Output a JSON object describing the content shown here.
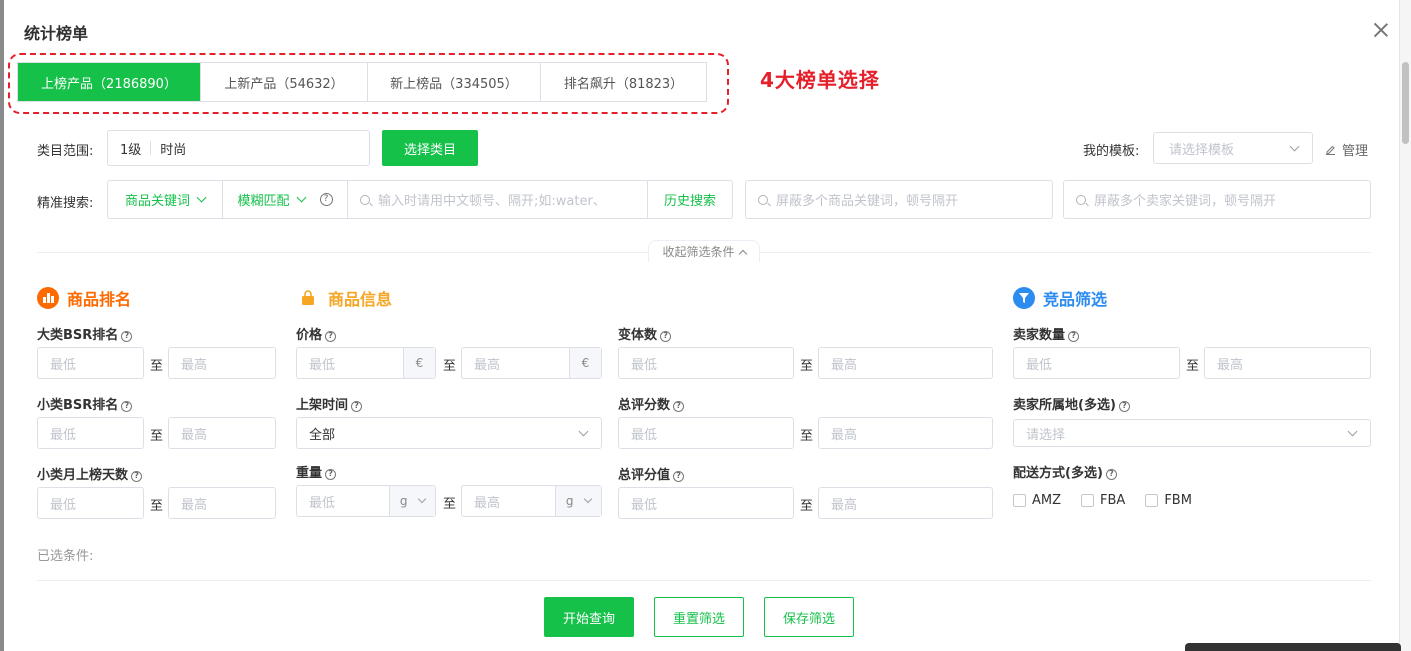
{
  "dialog": {
    "title": "统计榜单"
  },
  "tabs": [
    {
      "label": "上榜产品（2186890）"
    },
    {
      "label": "上新产品（54632）"
    },
    {
      "label": "新上榜品（334505）"
    },
    {
      "label": "排名飙升（81823）"
    }
  ],
  "annotation": "4大榜单选择",
  "category": {
    "label": "类目范围:",
    "level": "1级",
    "value": "时尚",
    "button": "选择类目"
  },
  "template": {
    "label": "我的模板:",
    "placeholder": "请选择模板",
    "manage": "管理"
  },
  "search": {
    "label": "精准搜索:",
    "field_type": "商品关键词",
    "match_type": "模糊匹配",
    "placeholder": "输入时请用中文顿号、隔开;如:water、",
    "history": "历史搜索",
    "block_product_placeholder": "屏蔽多个商品关键词，顿号隔开",
    "block_seller_placeholder": "屏蔽多个卖家关键词，顿号隔开"
  },
  "collapse": "收起筛选条件",
  "sections": {
    "ranking": {
      "title": "商品排名",
      "fields": {
        "big_bsr": "大类BSR排名",
        "small_bsr": "小类BSR排名",
        "small_month_days": "小类月上榜天数"
      }
    },
    "info": {
      "title": "商品信息",
      "fields": {
        "price": "价格",
        "price_unit": "€",
        "listing_time": "上架时间",
        "listing_time_value": "全部",
        "weight": "重量",
        "weight_unit": "g",
        "variants": "变体数",
        "total_ratings": "总评分数",
        "rating_value": "总评分值"
      }
    },
    "competitor": {
      "title": "竞品筛选",
      "fields": {
        "seller_count": "卖家数量",
        "seller_location": "卖家所属地(多选)",
        "seller_location_placeholder": "请选择",
        "delivery": "配送方式(多选)",
        "delivery_options": [
          "AMZ",
          "FBA",
          "FBM"
        ]
      }
    }
  },
  "range": {
    "min": "最低",
    "max": "最高",
    "to": "至"
  },
  "selected_label": "已选条件:",
  "actions": {
    "query": "开始查询",
    "reset": "重置筛选",
    "save": "保存筛选"
  },
  "colors": {
    "primary_green": "#16c14a",
    "annotation_red": "#e5202a",
    "ranking_orange": "#ff6a00",
    "info_orange": "#f5a623",
    "competitor_blue": "#2d8cf0"
  }
}
